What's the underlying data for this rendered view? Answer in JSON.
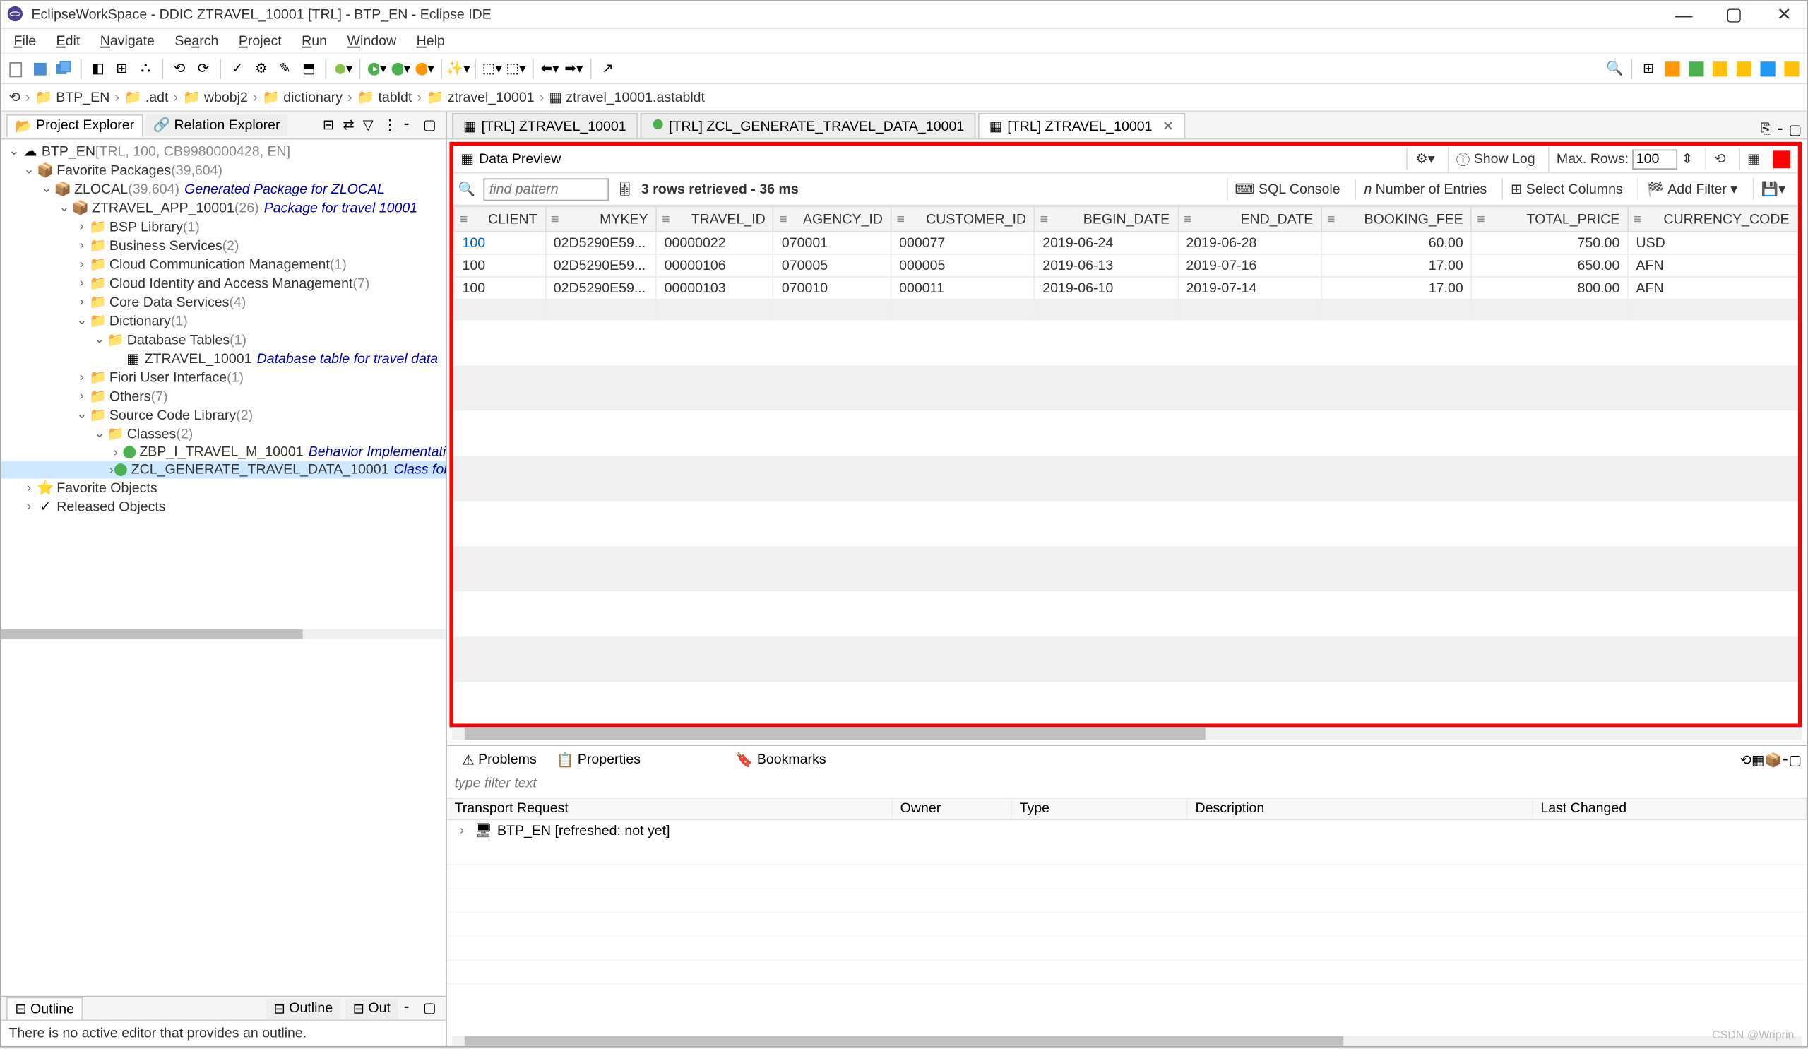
{
  "window": {
    "title": "EclipseWorkSpace - DDIC ZTRAVEL_10001 [TRL] - BTP_EN - Eclipse IDE"
  },
  "menu": [
    "File",
    "Edit",
    "Navigate",
    "Search",
    "Project",
    "Run",
    "Window",
    "Help"
  ],
  "breadcrumb": [
    "BTP_EN",
    ".adt",
    "wbobj2",
    "dictionary",
    "tabldt",
    "ztravel_10001",
    "ztravel_10001.astabldt"
  ],
  "left_views": {
    "project_explorer": "Project Explorer",
    "relation_explorer": "Relation Explorer"
  },
  "tree": {
    "root": "BTP_EN",
    "root_desc": "[TRL, 100, CB9980000428, EN]",
    "fav_pkg": "Favorite Packages",
    "fav_pkg_count": "(39,604)",
    "zlocal": "ZLOCAL",
    "zlocal_count": "(39,604)",
    "zlocal_desc": "Generated Package for ZLOCAL",
    "ztravel_app": "ZTRAVEL_APP_10001",
    "ztravel_app_count": "(26)",
    "ztravel_app_desc": "Package for travel 10001",
    "bsp": "BSP Library",
    "bsp_count": "(1)",
    "business": "Business Services",
    "business_count": "(2)",
    "cloud_comm": "Cloud Communication Management",
    "cloud_comm_count": "(1)",
    "cloud_id": "Cloud Identity and Access Management",
    "cloud_id_count": "(7)",
    "core_data": "Core Data Services",
    "core_data_count": "(4)",
    "dict": "Dictionary",
    "dict_count": "(1)",
    "db_tables": "Database Tables",
    "db_tables_count": "(1)",
    "ztravel_table": "ZTRAVEL_10001",
    "ztravel_table_desc": "Database table for travel data",
    "fiori": "Fiori User Interface",
    "fiori_count": "(1)",
    "others": "Others",
    "others_count": "(7)",
    "source_lib": "Source Code Library",
    "source_lib_count": "(2)",
    "classes": "Classes",
    "classes_count": "(2)",
    "zbp": "ZBP_I_TRAVEL_M_10001",
    "zbp_desc": "Behavior Implementati",
    "zcl": "ZCL_GENERATE_TRAVEL_DATA_10001",
    "zcl_desc": "Class for",
    "fav_obj": "Favorite Objects",
    "rel_obj": "Released Objects"
  },
  "outline": {
    "title": "Outline",
    "msg": "There is no active editor that provides an outline.",
    "tab2": "Outline",
    "tab3": "Out"
  },
  "editor_tabs": [
    {
      "label": "[TRL] ZTRAVEL_10001",
      "icon": "table"
    },
    {
      "label": "[TRL] ZCL_GENERATE_TRAVEL_DATA_10001",
      "icon": "class"
    },
    {
      "label": "[TRL] ZTRAVEL_10001",
      "icon": "table",
      "active": true
    }
  ],
  "data_preview": {
    "title": "Data Preview",
    "find_placeholder": "find pattern",
    "status": "3 rows retrieved - 36 ms",
    "sql_console": "SQL Console",
    "num_entries": "Number of Entries",
    "select_cols": "Select Columns",
    "add_filter": "Add Filter",
    "show_log": "Show Log",
    "max_rows_label": "Max. Rows:",
    "max_rows": "100",
    "columns": [
      "CLIENT",
      "MYKEY",
      "TRAVEL_ID",
      "AGENCY_ID",
      "CUSTOMER_ID",
      "BEGIN_DATE",
      "END_DATE",
      "BOOKING_FEE",
      "TOTAL_PRICE",
      "CURRENCY_CODE"
    ],
    "rows": [
      [
        "100",
        "02D5290E59...",
        "00000022",
        "070001",
        "000077",
        "2019-06-24",
        "2019-06-28",
        "60.00",
        "750.00",
        "USD"
      ],
      [
        "100",
        "02D5290E59...",
        "00000106",
        "070005",
        "000005",
        "2019-06-13",
        "2019-07-16",
        "17.00",
        "650.00",
        "AFN"
      ],
      [
        "100",
        "02D5290E59...",
        "00000103",
        "070010",
        "000011",
        "2019-06-10",
        "2019-07-14",
        "17.00",
        "800.00",
        "AFN"
      ]
    ]
  },
  "bottom": {
    "problems": "Problems",
    "properties": "Properties",
    "bookmarks": "Bookmarks",
    "filter_placeholder": "type filter text",
    "th": [
      "Transport Request",
      "Owner",
      "Type",
      "Description",
      "Last Changed"
    ],
    "row1": "BTP_EN [refreshed: not yet]"
  },
  "watermark": "CSDN @Wriprin"
}
